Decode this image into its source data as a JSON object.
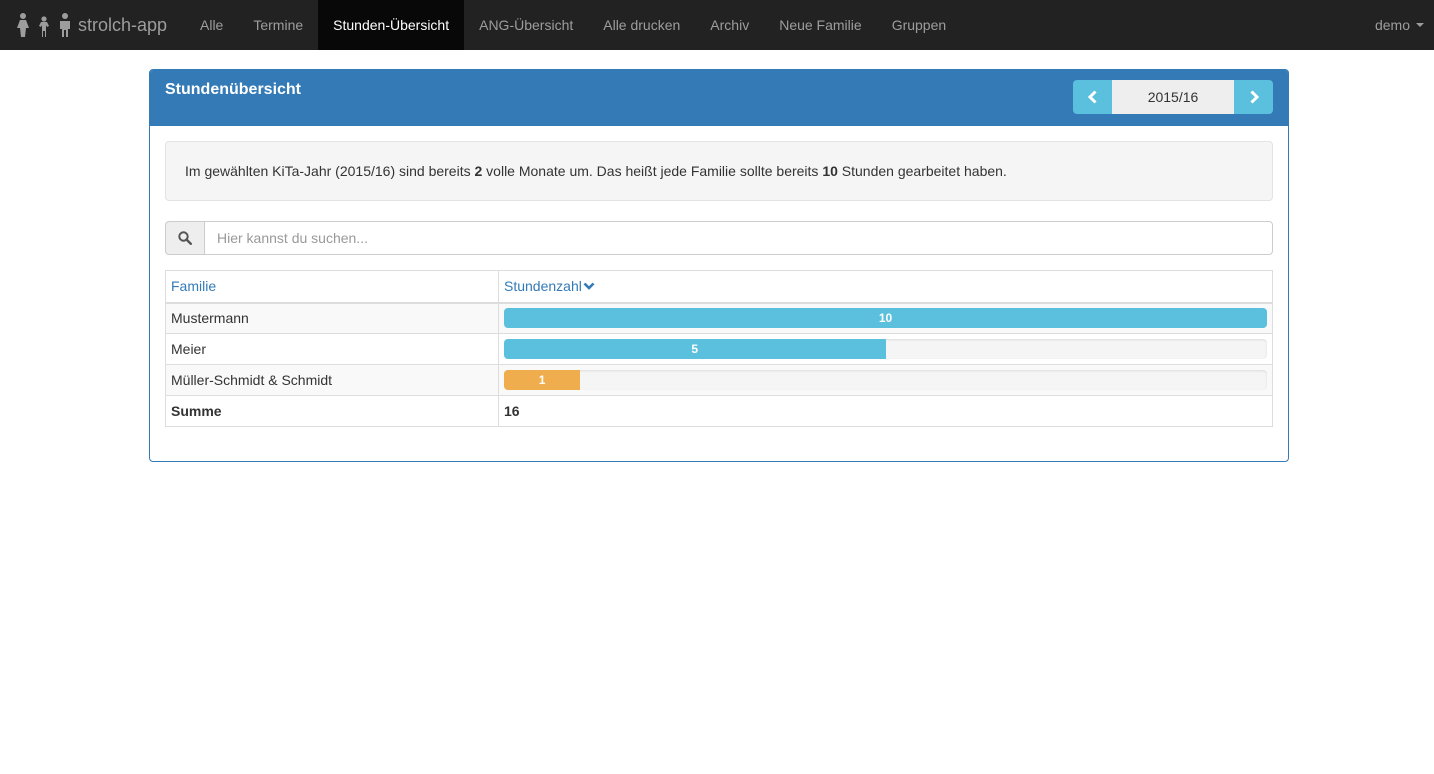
{
  "navbar": {
    "brand": "strolch-app",
    "items": [
      {
        "label": "Alle",
        "active": false
      },
      {
        "label": "Termine",
        "active": false
      },
      {
        "label": "Stunden-Übersicht",
        "active": true
      },
      {
        "label": "ANG-Übersicht",
        "active": false
      },
      {
        "label": "Alle drucken",
        "active": false
      },
      {
        "label": "Archiv",
        "active": false
      },
      {
        "label": "Neue Familie",
        "active": false
      },
      {
        "label": "Gruppen",
        "active": false
      }
    ],
    "user": "demo"
  },
  "panel": {
    "title": "Stundenübersicht",
    "year": "2015/16",
    "prev_icon": "chevron-left-icon",
    "next_icon": "chevron-right-icon"
  },
  "info": {
    "part1": "Im gewählten KiTa-Jahr (2015/16) sind bereits ",
    "months": "2",
    "part2": " volle Monate um. Das heißt jede Familie sollte bereits ",
    "hours": "10",
    "part3": " Stunden gearbeitet haben."
  },
  "search": {
    "placeholder": "Hier kannst du suchen...",
    "value": "",
    "icon": "search-icon"
  },
  "table": {
    "col_family": "Familie",
    "col_hours": "Stundenzahl",
    "target_hours": 10,
    "rows": [
      {
        "family": "Mustermann",
        "hours": "10",
        "fraction": 1.0,
        "color": "#5bc0de"
      },
      {
        "family": "Meier",
        "hours": "5",
        "fraction": 0.5,
        "color": "#5bc0de"
      },
      {
        "family": "Müller-Schmidt & Schmidt",
        "hours": "1",
        "fraction": 0.1,
        "color": "#f0ad4e"
      }
    ],
    "sum_label": "Summe",
    "sum_value": "16"
  }
}
